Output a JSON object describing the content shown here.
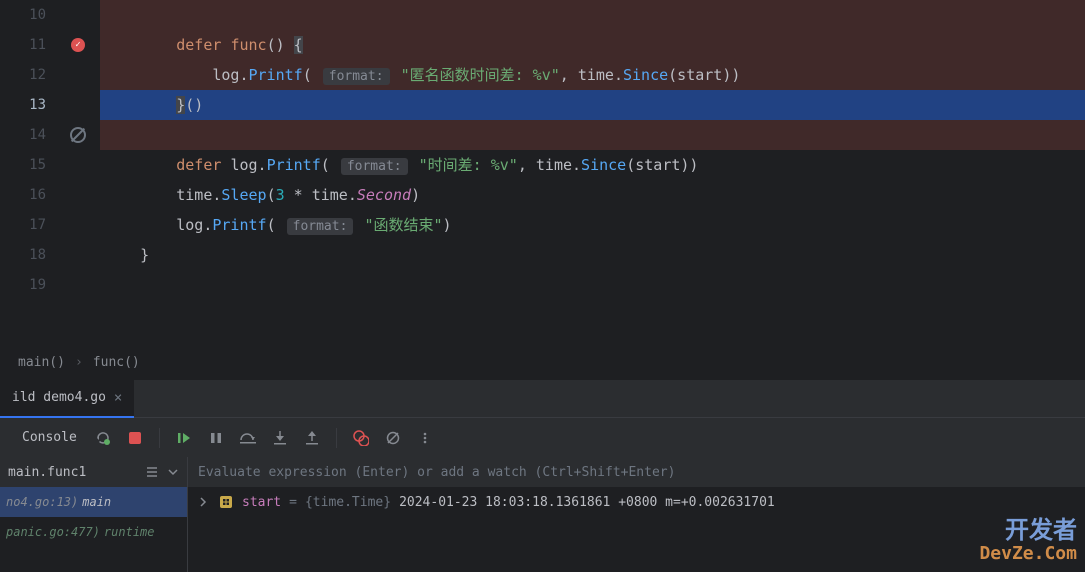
{
  "lines": {
    "10": "10",
    "11": "11",
    "12": "12",
    "13": "13",
    "14": "14",
    "15": "15",
    "16": "16",
    "17": "17",
    "18": "18",
    "19": "19"
  },
  "code": {
    "l10": {
      "ind": "        "
    },
    "l11": {
      "ind": "        ",
      "kw": "defer ",
      "fn": "func",
      "rest": "() {"
    },
    "l12": {
      "ind": "            ",
      "pkg": "log",
      "dot": ".",
      "fn": "Printf",
      "open": "(",
      "hint": "format:",
      "str": "\"匿名函数时间差: %v\"",
      "comma": ", ",
      "pkg2": "time",
      "dot2": ".",
      "fn2": "Since",
      "open2": "(",
      "arg": "start",
      "close": "))"
    },
    "l13": {
      "ind": "        ",
      "brace": "}",
      "rest": "()"
    },
    "l14": {
      "ind": ""
    },
    "l15": {
      "ind": "        ",
      "kw": "defer ",
      "pkg": "log",
      "dot": ".",
      "fn": "Printf",
      "open": "(",
      "hint": "format:",
      "str": "\"时间差: %v\"",
      "comma": ", ",
      "pkg2": "time",
      "dot2": ".",
      "fn2": "Since",
      "open2": "(",
      "arg": "start",
      "close": "))"
    },
    "l16": {
      "ind": "        ",
      "pkg": "time",
      "dot": ".",
      "fn": "Sleep",
      "open": "(",
      "num": "3",
      "op": " * ",
      "pkg2": "time",
      "dot2": ".",
      "ident": "Second",
      "close": ")"
    },
    "l17": {
      "ind": "        ",
      "pkg": "log",
      "dot": ".",
      "fn": "Printf",
      "open": "(",
      "hint": "format:",
      "str": "\"函数结束\"",
      "close": ")"
    },
    "l18": {
      "ind": "    ",
      "brace": "}"
    },
    "l19": {
      "ind": ""
    }
  },
  "breadcrumb": {
    "item1": "main()",
    "item2": "func()"
  },
  "tab": {
    "label": "ild demo4.go"
  },
  "toolbar": {
    "console": "Console"
  },
  "frames": {
    "header": "main.func1",
    "f1": {
      "loc": "no4.go:13)",
      "name": "main"
    },
    "f2": {
      "loc": "panic.go:477)",
      "name": "runtime"
    }
  },
  "eval": {
    "placeholder": "Evaluate expression (Enter) or add a watch (Ctrl+Shift+Enter)"
  },
  "var": {
    "name": "start",
    "eq": "=",
    "type": "{time.Time}",
    "val": "2024-01-23 18:03:18.1361861 +0800 m=+0.002631701"
  },
  "watermark": {
    "l1": "开发者",
    "l2": "DevZe.Com"
  }
}
